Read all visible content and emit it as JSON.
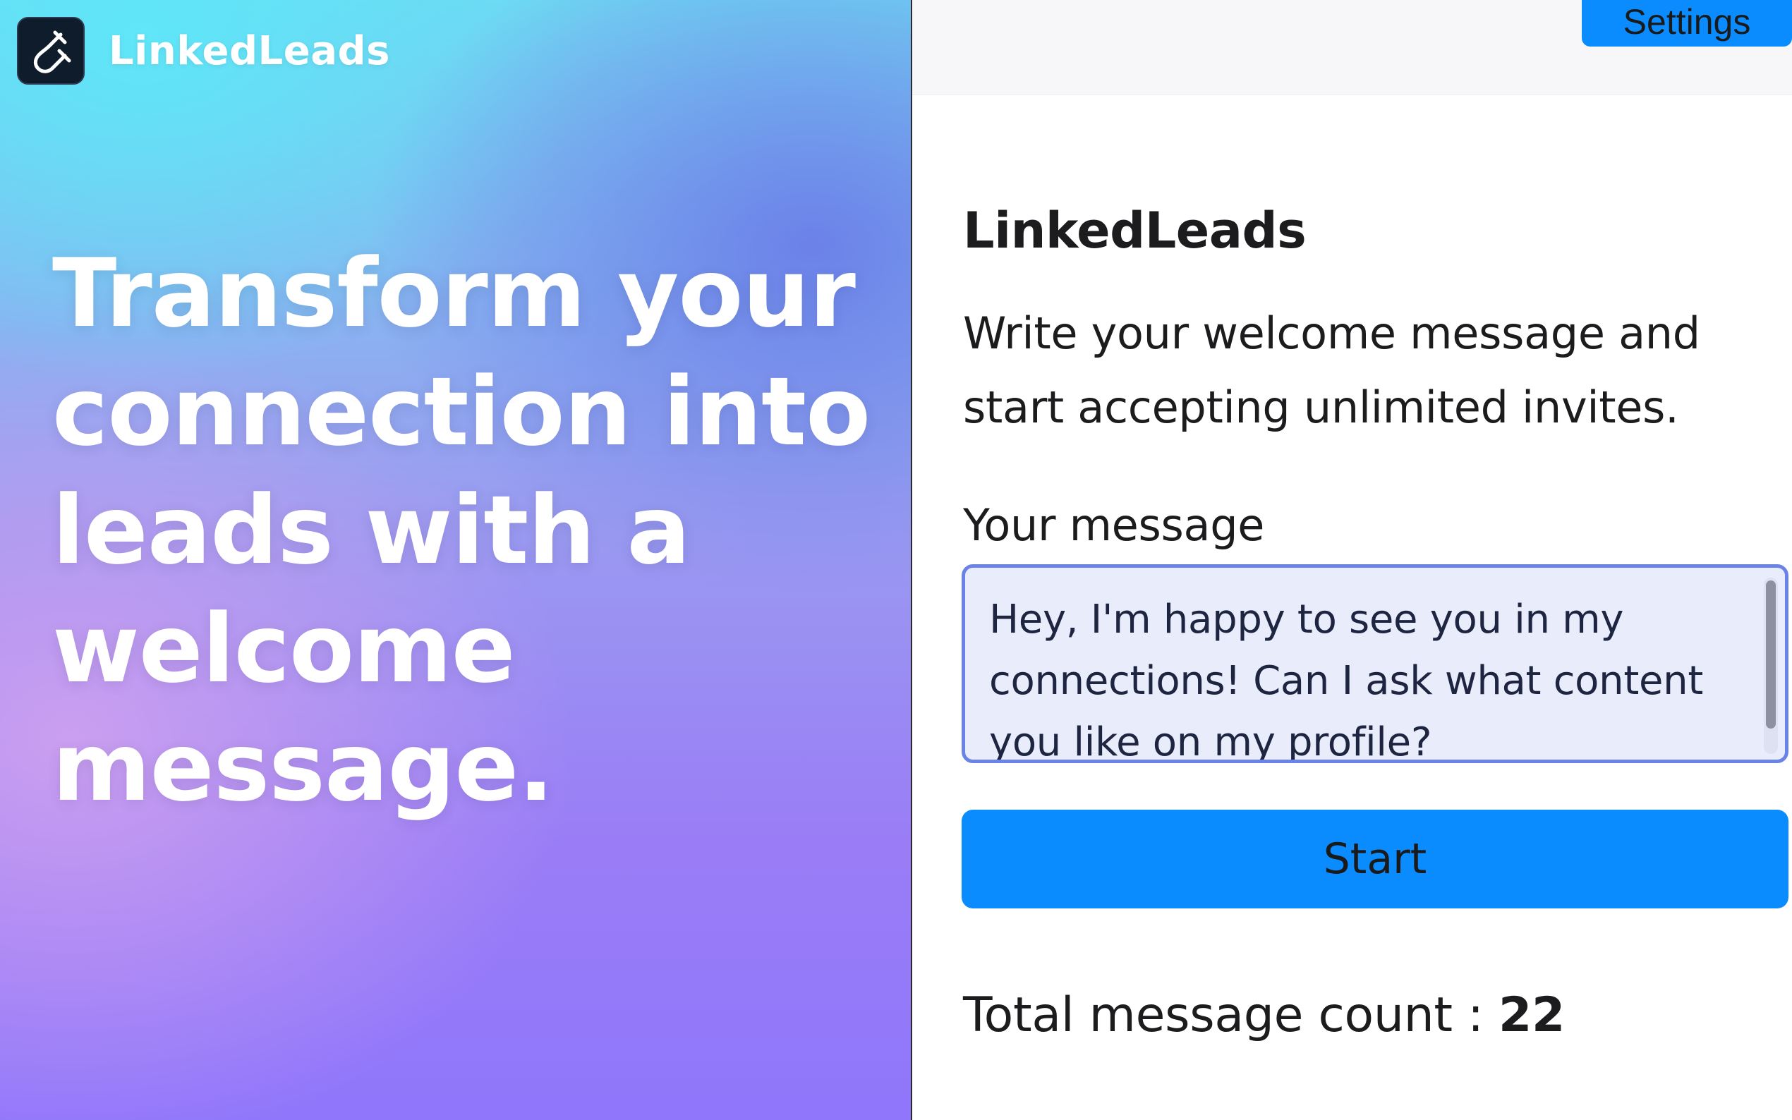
{
  "brand": {
    "name": "LinkedLeads",
    "logo_icon": "magnet-icon"
  },
  "hero": {
    "headline": "Transform your connection into leads with a welcome message."
  },
  "topbar": {
    "settings_label": "Settings"
  },
  "panel": {
    "title": "LinkedLeads",
    "description": "Write your welcome message and start accepting unlimited invites.",
    "message_label": "Your message",
    "message_value": "Hey, I'm happy to see you in my connections! Can I ask what content you like on my profile?",
    "start_label": "Start",
    "total_label": "Total message count : ",
    "total_count": "22"
  },
  "colors": {
    "accent_blue": "#0a8cff",
    "focus_border": "#6b83e6",
    "textarea_bg": "#e9edfb"
  }
}
